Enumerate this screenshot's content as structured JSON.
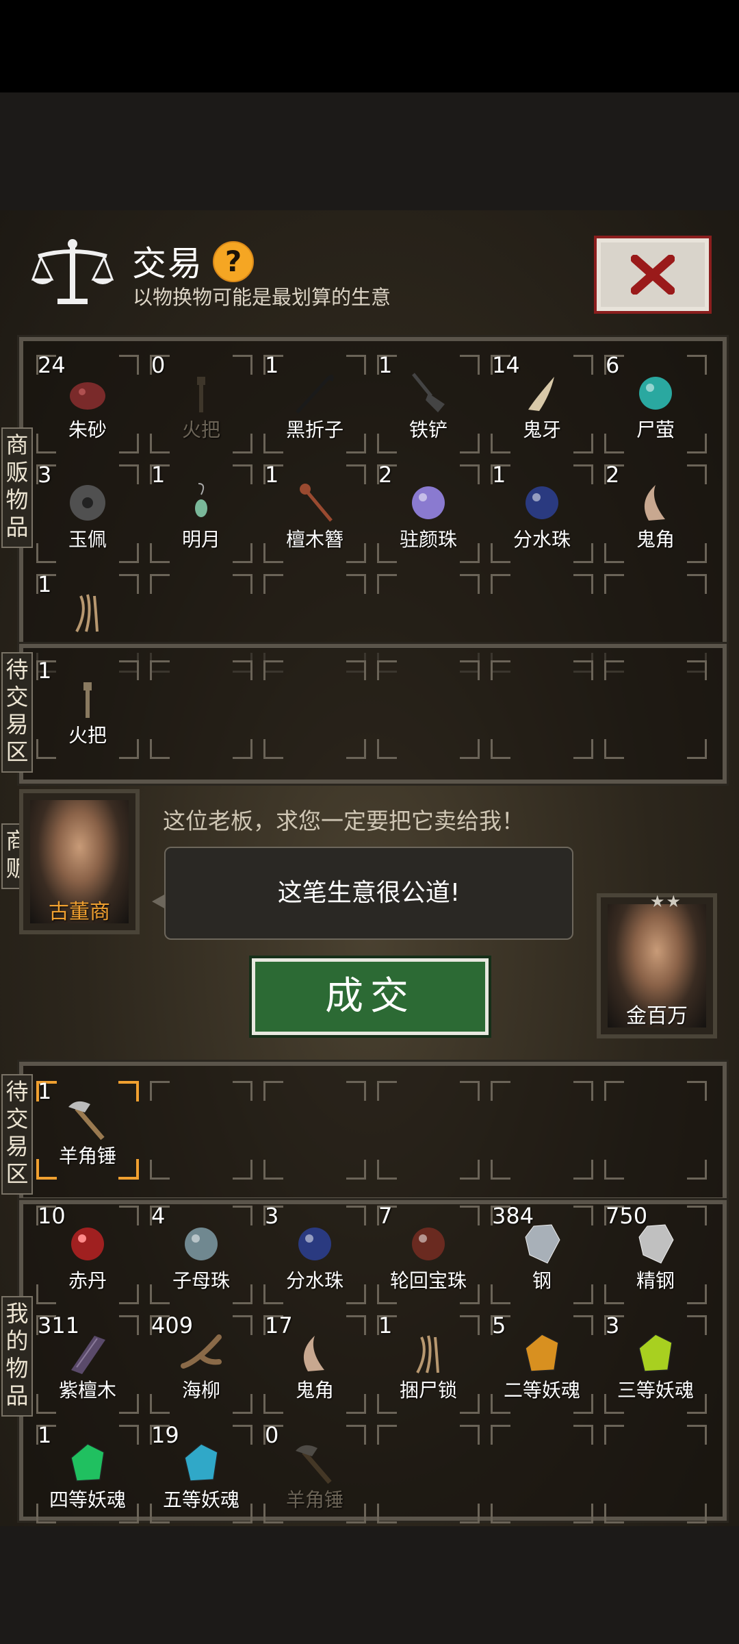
{
  "header": {
    "title": "交易",
    "help_icon": "?",
    "subtitle": "以物换物可能是最划算的生意",
    "close_icon": "close-x-icon"
  },
  "side_labels": {
    "merchant_goods": "商贩物品",
    "pending_top": "待交易区",
    "merchant": "商贩",
    "pending_bottom": "待交易区",
    "my_goods": "我的物品"
  },
  "merchant_items": [
    {
      "count": "24",
      "name": "朱砂",
      "icon": "cinnabar-icon",
      "color": "#7a2a2a"
    },
    {
      "count": "0",
      "name": "火把",
      "icon": "torch-icon",
      "color": "#8a7a60",
      "faded": true
    },
    {
      "count": "1",
      "name": "黑折子",
      "icon": "hook-icon",
      "color": "#1a1a1a"
    },
    {
      "count": "1",
      "name": "铁铲",
      "icon": "shovel-icon",
      "color": "#444"
    },
    {
      "count": "14",
      "name": "鬼牙",
      "icon": "fang-icon",
      "color": "#d8c8a8"
    },
    {
      "count": "6",
      "name": "尸萤",
      "icon": "orb-icon",
      "color": "#2aa8a0"
    },
    {
      "count": "3",
      "name": "玉佩",
      "icon": "jade-pendant-icon",
      "color": "#505050"
    },
    {
      "count": "1",
      "name": "明月",
      "icon": "earring-icon",
      "color": "#7ab89a"
    },
    {
      "count": "1",
      "name": "檀木簪",
      "icon": "hairpin-icon",
      "color": "#9a4a30"
    },
    {
      "count": "2",
      "name": "驻颜珠",
      "icon": "pearl-icon",
      "color": "#8a7ad0"
    },
    {
      "count": "1",
      "name": "分水珠",
      "icon": "pearl-icon",
      "color": "#2a3a80"
    },
    {
      "count": "2",
      "name": "鬼角",
      "icon": "horn-icon",
      "color": "#c8a890"
    },
    {
      "count": "1",
      "name": "",
      "icon": "rope-icon",
      "color": "#b89870"
    }
  ],
  "merchant_pending": [
    {
      "count": "1",
      "name": "火把",
      "icon": "torch-icon",
      "color": "#8a7a60"
    }
  ],
  "merchant": {
    "name": "古董商",
    "request_text": "这位老板，求您一定要把它卖给我！",
    "speech": "这笔生意很公道!"
  },
  "deal_button": "成交",
  "player": {
    "name": "金百万",
    "stars": "★★"
  },
  "my_pending": [
    {
      "count": "1",
      "name": "羊角锤",
      "icon": "hammer-icon",
      "color": "#9a7a50",
      "selected": true
    }
  ],
  "my_items": [
    {
      "count": "10",
      "name": "赤丹",
      "icon": "red-pill-icon",
      "color": "#a02020"
    },
    {
      "count": "4",
      "name": "子母珠",
      "icon": "pearl-icon",
      "color": "#708890"
    },
    {
      "count": "3",
      "name": "分水珠",
      "icon": "pearl-icon",
      "color": "#2a3a80"
    },
    {
      "count": "7",
      "name": "轮回宝珠",
      "icon": "orb-icon",
      "color": "#6a2a20"
    },
    {
      "count": "384",
      "name": "钢",
      "icon": "ore-icon",
      "color": "#a8b0b8"
    },
    {
      "count": "750",
      "name": "精钢",
      "icon": "ore-icon",
      "color": "#c0c0c0"
    },
    {
      "count": "311",
      "name": "紫檀木",
      "icon": "wood-icon",
      "color": "#5a4a6a"
    },
    {
      "count": "409",
      "name": "海柳",
      "icon": "branch-icon",
      "color": "#8a6a48"
    },
    {
      "count": "17",
      "name": "鬼角",
      "icon": "horn-icon",
      "color": "#c8a890"
    },
    {
      "count": "1",
      "name": "捆尸锁",
      "icon": "rope-icon",
      "color": "#b89870"
    },
    {
      "count": "5",
      "name": "二等妖魂",
      "icon": "crystal-icon",
      "color": "#d89020"
    },
    {
      "count": "3",
      "name": "三等妖魂",
      "icon": "crystal-icon",
      "color": "#a8d020"
    },
    {
      "count": "1",
      "name": "四等妖魂",
      "icon": "crystal-icon",
      "color": "#20c060"
    },
    {
      "count": "19",
      "name": "五等妖魂",
      "icon": "crystal-icon",
      "color": "#30a8c8"
    },
    {
      "count": "0",
      "name": "羊角锤",
      "icon": "hammer-icon",
      "color": "#9a7a50",
      "faded": true
    }
  ]
}
